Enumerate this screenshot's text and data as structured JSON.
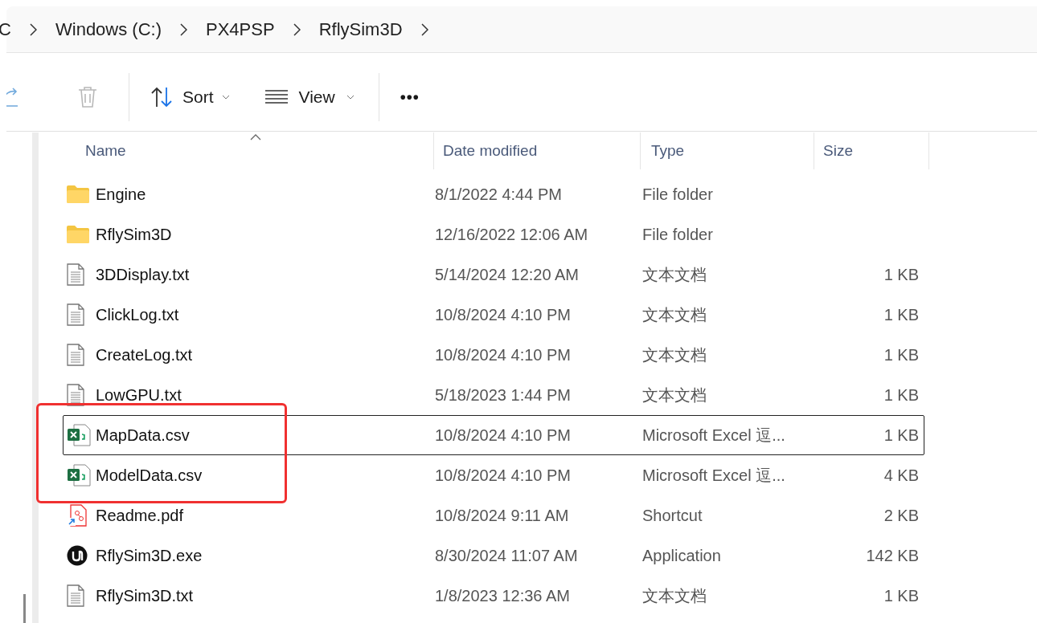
{
  "breadcrumb": [
    "C",
    "Windows (C:)",
    "PX4PSP",
    "RflySim3D"
  ],
  "toolbar": {
    "sort": "Sort",
    "view": "View",
    "more": "•••"
  },
  "columns": [
    "Name",
    "Date modified",
    "Type",
    "Size"
  ],
  "rows": [
    {
      "kind": "folder",
      "name": "Engine",
      "date": "8/1/2022 4:44 PM",
      "type": "File folder",
      "size": "",
      "focused": false
    },
    {
      "kind": "folder",
      "name": "RflySim3D",
      "date": "12/16/2022 12:06 AM",
      "type": "File folder",
      "size": "",
      "focused": false
    },
    {
      "kind": "text",
      "name": "3DDisplay.txt",
      "date": "5/14/2024 12:20 AM",
      "type": "文本文档",
      "size": "1 KB",
      "focused": false
    },
    {
      "kind": "text",
      "name": "ClickLog.txt",
      "date": "10/8/2024 4:10 PM",
      "type": "文本文档",
      "size": "1 KB",
      "focused": false
    },
    {
      "kind": "text",
      "name": "CreateLog.txt",
      "date": "10/8/2024 4:10 PM",
      "type": "文本文档",
      "size": "1 KB",
      "focused": false
    },
    {
      "kind": "text",
      "name": "LowGPU.txt",
      "date": "5/18/2023 1:44 PM",
      "type": "文本文档",
      "size": "1 KB",
      "focused": false
    },
    {
      "kind": "excel",
      "name": "MapData.csv",
      "date": "10/8/2024 4:10 PM",
      "type": "Microsoft Excel 逗...",
      "size": "1 KB",
      "focused": true
    },
    {
      "kind": "excel",
      "name": "ModelData.csv",
      "date": "10/8/2024 4:10 PM",
      "type": "Microsoft Excel 逗...",
      "size": "4 KB",
      "focused": false
    },
    {
      "kind": "shortcut",
      "name": "Readme.pdf",
      "date": "10/8/2024 9:11 AM",
      "type": "Shortcut",
      "size": "2 KB",
      "focused": false
    },
    {
      "kind": "app",
      "name": "RflySim3D.exe",
      "date": "8/30/2024 11:07 AM",
      "type": "Application",
      "size": "142 KB",
      "focused": false
    },
    {
      "kind": "text",
      "name": "RflySim3D.txt",
      "date": "1/8/2023 12:36 AM",
      "type": "文本文档",
      "size": "1 KB",
      "focused": false
    }
  ]
}
